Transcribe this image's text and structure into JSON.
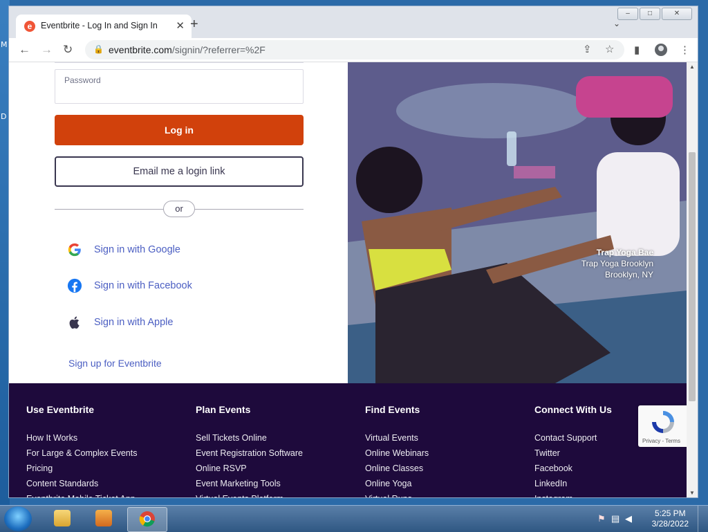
{
  "desktop": {
    "glyph_top": "M",
    "glyph_mid": "D"
  },
  "browser": {
    "tab": {
      "title": "Eventbrite - Log In and Sign In",
      "favicon": "e"
    },
    "url_domain": "eventbrite.com",
    "url_path": "/signin/?referrer=%2F",
    "icons": {
      "back": "←",
      "forward": "→",
      "reload": "↻",
      "lock": "🔒",
      "share": "⇪",
      "bookmark": "☆",
      "sidepanel": "▮",
      "menu": "⋮",
      "close_tab": "✕",
      "new_tab": "+",
      "tab_search": "⌄"
    },
    "window_buttons": {
      "minimize": "–",
      "maximize": "□",
      "close": "✕"
    }
  },
  "login": {
    "password_label": "Password",
    "login_button": "Log in",
    "email_link_button": "Email me a login link",
    "divider": "or",
    "social": [
      {
        "label": "Sign in with Google"
      },
      {
        "label": "Sign in with Facebook"
      },
      {
        "label": "Sign in with Apple"
      }
    ],
    "signup_link": "Sign up for Eventbrite"
  },
  "photo": {
    "caption_title": "Trap Yoga Bae",
    "caption_line2": "Trap Yoga Brooklyn",
    "caption_line3": "Brooklyn, NY"
  },
  "footer": {
    "columns": [
      {
        "heading": "Use Eventbrite",
        "links": [
          "How It Works",
          "For Large & Complex Events",
          "Pricing",
          "Content Standards",
          "Eventbrite Mobile Ticket App"
        ]
      },
      {
        "heading": "Plan Events",
        "links": [
          "Sell Tickets Online",
          "Event Registration Software",
          "Online RSVP",
          "Event Marketing Tools",
          "Virtual Events Platform"
        ]
      },
      {
        "heading": "Find Events",
        "links": [
          "Virtual Events",
          "Online Webinars",
          "Online Classes",
          "Online Yoga",
          "Virtual Runs"
        ]
      },
      {
        "heading": "Connect With Us",
        "links": [
          "Contact Support",
          "Twitter",
          "Facebook",
          "LinkedIn",
          "Instagram"
        ]
      }
    ],
    "recaptcha_terms": "Privacy - Terms"
  },
  "taskbar": {
    "time": "5:25 PM",
    "date": "3/28/2022"
  },
  "colors": {
    "brand_orange": "#d1410c",
    "footer_bg": "#1e0a3c",
    "link_blue": "#4b5ec2"
  }
}
